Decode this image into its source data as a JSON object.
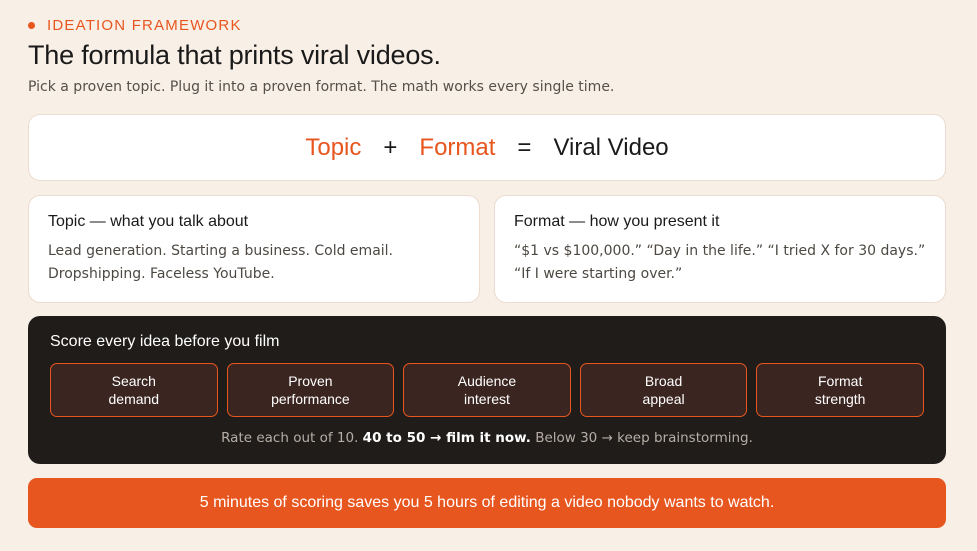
{
  "eyebrow": "IDEATION FRAMEWORK",
  "title": "The formula that prints viral videos.",
  "subtitle": "Pick a proven topic. Plug it into a proven format. The math works every single time.",
  "formula": {
    "topic": "Topic",
    "plus": "+",
    "format": "Format",
    "equals": "=",
    "result": "Viral Video"
  },
  "cards": {
    "topic": {
      "heading": "Topic — what you talk about",
      "body": "Lead generation. Starting a business. Cold email. Dropshipping. Faceless YouTube."
    },
    "format": {
      "heading": "Format — how you present it",
      "body": "“$1 vs $100,000.” “Day in the life.” “I tried X for 30 days.” “If I were starting over.”"
    }
  },
  "score": {
    "heading": "Score every idea before you film",
    "criteria": [
      {
        "line1": "Search",
        "line2": "demand"
      },
      {
        "line1": "Proven",
        "line2": "performance"
      },
      {
        "line1": "Audience",
        "line2": "interest"
      },
      {
        "line1": "Broad",
        "line2": "appeal"
      },
      {
        "line1": "Format",
        "line2": "strength"
      }
    ],
    "note_pre": "Rate each out of 10.",
    "note_bold": "40 to 50 → film it now.",
    "note_post": "Below 30 → keep brainstorming."
  },
  "banner": "5 minutes of scoring saves you 5 hours of editing a video nobody wants to watch.",
  "colors": {
    "accent": "#e8561f",
    "background": "#f8efe6",
    "dark_panel": "#1f1c1a"
  }
}
